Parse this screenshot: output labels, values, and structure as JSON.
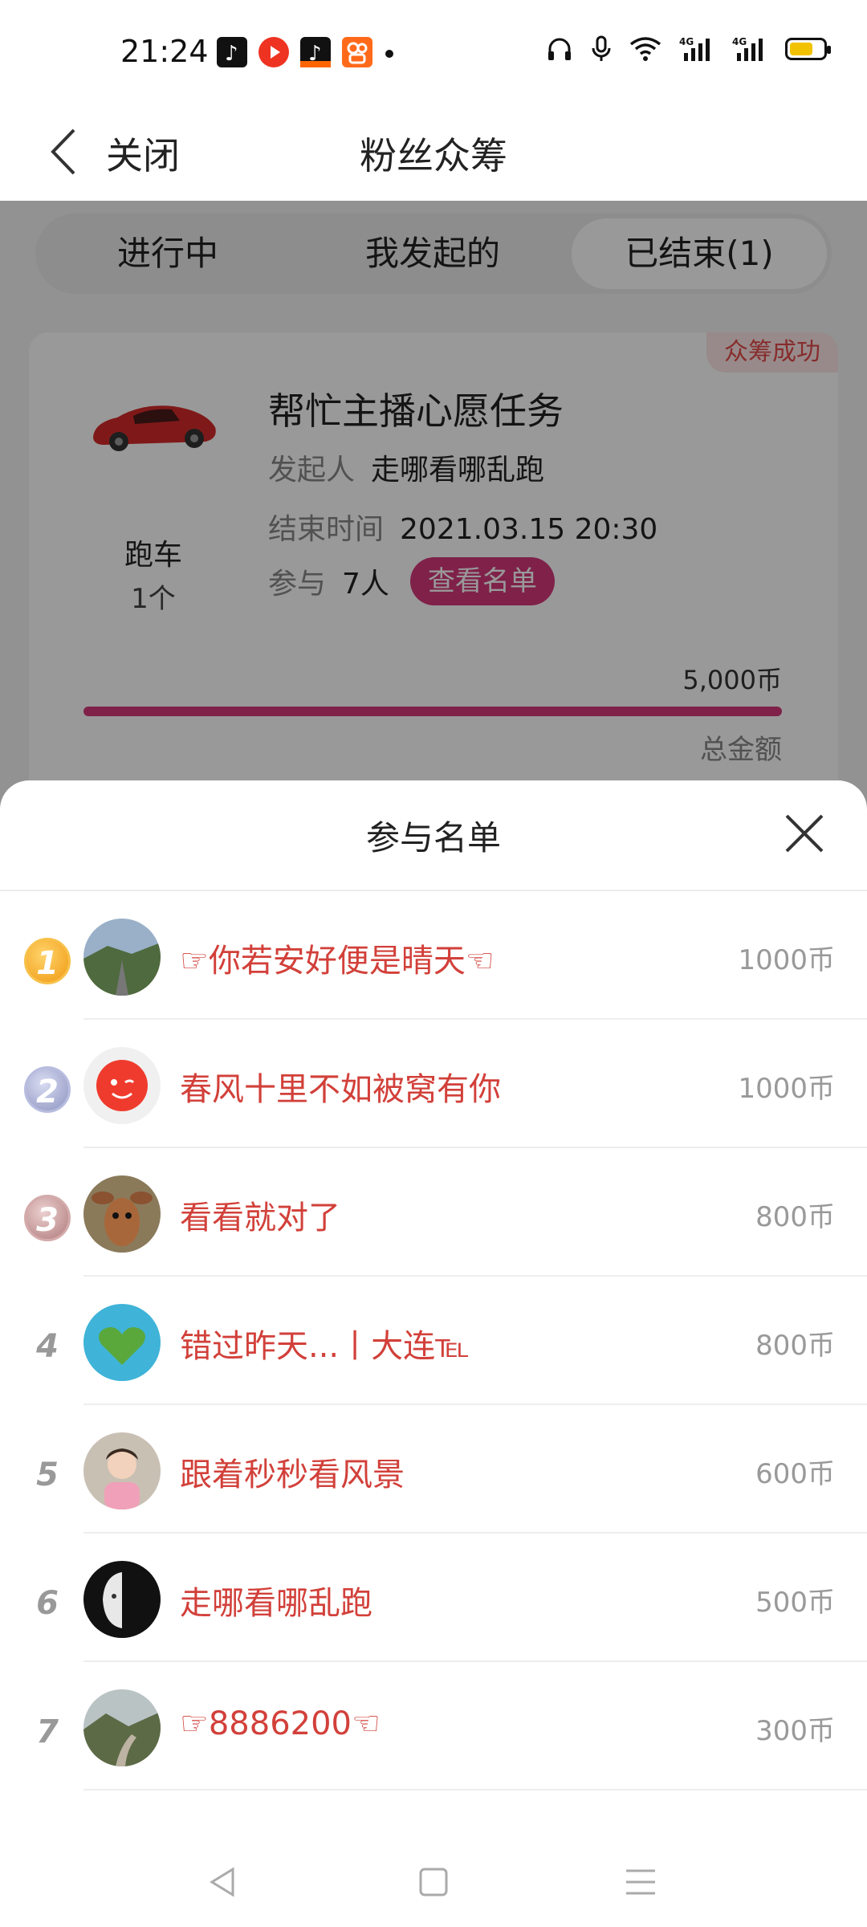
{
  "status_bar": {
    "time": "21:24",
    "icons": [
      "tiktok-app-icon",
      "red-record-icon",
      "tiktok-app-icon-2",
      "kuaishou-app-icon",
      "headphone-icon",
      "mic-icon",
      "wifi-icon",
      "signal-4g-icon",
      "signal-4g-icon-2",
      "battery-icon"
    ],
    "network_label": "4G",
    "battery_level": 0.65
  },
  "header": {
    "back_label": "关闭",
    "title": "粉丝众筹"
  },
  "tabs": [
    {
      "label": "进行中",
      "active": false
    },
    {
      "label": "我发起的",
      "active": false
    },
    {
      "label": "已结束(1)",
      "active": true
    }
  ],
  "card": {
    "badge": "众筹成功",
    "gift_name": "跑车",
    "gift_count": "1个",
    "task_title": "帮忙主播心愿任务",
    "initiator_label": "发起人",
    "initiator_value": "走哪看哪乱跑",
    "end_time_label": "结束时间",
    "end_time_value": "2021.03.15 20:30",
    "participants_label": "参与",
    "participants_value": "7人",
    "view_list_button": "查看名单",
    "amount": "5,000币",
    "progress": 1.0,
    "total_label": "总金额"
  },
  "sheet": {
    "title": "参与名单",
    "rows": [
      {
        "rank": "1",
        "name": "☞你若安好便是晴天☜",
        "coins": "1000币"
      },
      {
        "rank": "2",
        "name": "春风十里不如被窝有你",
        "coins": "1000币"
      },
      {
        "rank": "3",
        "name": "看看就对了",
        "coins": "800币"
      },
      {
        "rank": "4",
        "name": "错过昨天...丨大连℡",
        "coins": "800币"
      },
      {
        "rank": "5",
        "name": "跟着秒秒看风景",
        "coins": "600币"
      },
      {
        "rank": "6",
        "name": "走哪看哪乱跑",
        "coins": "500币"
      },
      {
        "rank": "7",
        "name": "☞8886200☜",
        "coins": "300币"
      }
    ]
  },
  "colors": {
    "accent": "#d4377a",
    "name_red": "#d2403a",
    "gold": "#f0a020",
    "silver": "#9aa0c8",
    "bronze": "#c08a8a"
  }
}
